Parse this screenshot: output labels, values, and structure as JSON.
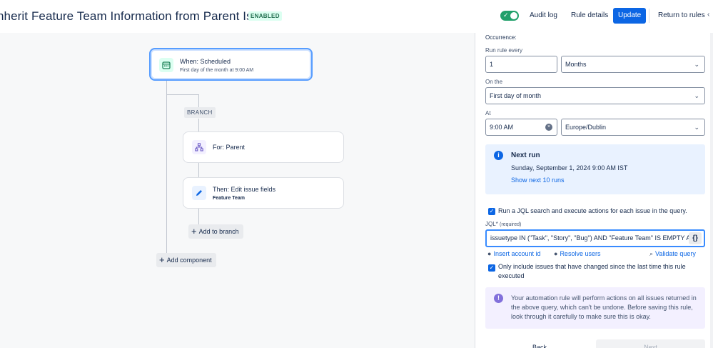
{
  "header": {
    "title": "nherit Feature Team Information from Parent Issue",
    "status_badge": "ENABLED",
    "toggle_state": "on",
    "audit_log": "Audit log",
    "rule_details": "Rule details",
    "update": "Update",
    "return_to_rules": "Return to rules",
    "more": "‹"
  },
  "canvas": {
    "trigger": {
      "title": "When: Scheduled",
      "subtitle": "First day of the month at 9:00 AM",
      "icon": "calendar-icon"
    },
    "branch_label": "BRANCH",
    "branch_node": {
      "title": "For: Parent",
      "icon": "hierarchy-icon"
    },
    "action_node": {
      "title": "Then: Edit issue fields",
      "subtitle": "Feature Team",
      "icon": "pencil-icon"
    },
    "add_to_branch": "Add to branch",
    "add_component": "Add component"
  },
  "panel": {
    "occurrence_label": "Occurrence:",
    "run_every_label": "Run rule every",
    "run_every_value": "1",
    "period_value": "Months",
    "on_the_label": "On the",
    "on_the_value": "First day of month",
    "at_label": "At",
    "time_value": "9:00 AM",
    "timezone_value": "Europe/Dublin",
    "next_run": {
      "title": "Next run",
      "date": "Sunday, September 1, 2024 9:00 AM IST",
      "link": "Show next 10 runs"
    },
    "jql_checkbox_label": "Run a JQL search and execute actions for each issue in the query.",
    "jql_label": "JQL*",
    "jql_required": "(required)",
    "jql_value": "issuetype IN (\"Task\", \"Story\", \"Bug\") AND \"Feature Team\" IS EMPTY AND",
    "jql_brace": "{}",
    "insert_account_id": "Insert account id",
    "resolve_users": "Resolve users",
    "validate_query": "Validate query",
    "changed_checkbox_label": "Only include issues that have changed since the last time this rule executed",
    "warning_text": "Your automation rule will perform actions on all issues returned in the above query, which can't be undone. Before saving this rule, look through it carefully to make sure this is okay.",
    "back": "Back",
    "next": "Next"
  },
  "colors": {
    "primary": "#0c66e4",
    "enabled_green": "#22a06b",
    "info_bg": "#e9f2ff",
    "warning_bg": "#f3f0ff"
  }
}
